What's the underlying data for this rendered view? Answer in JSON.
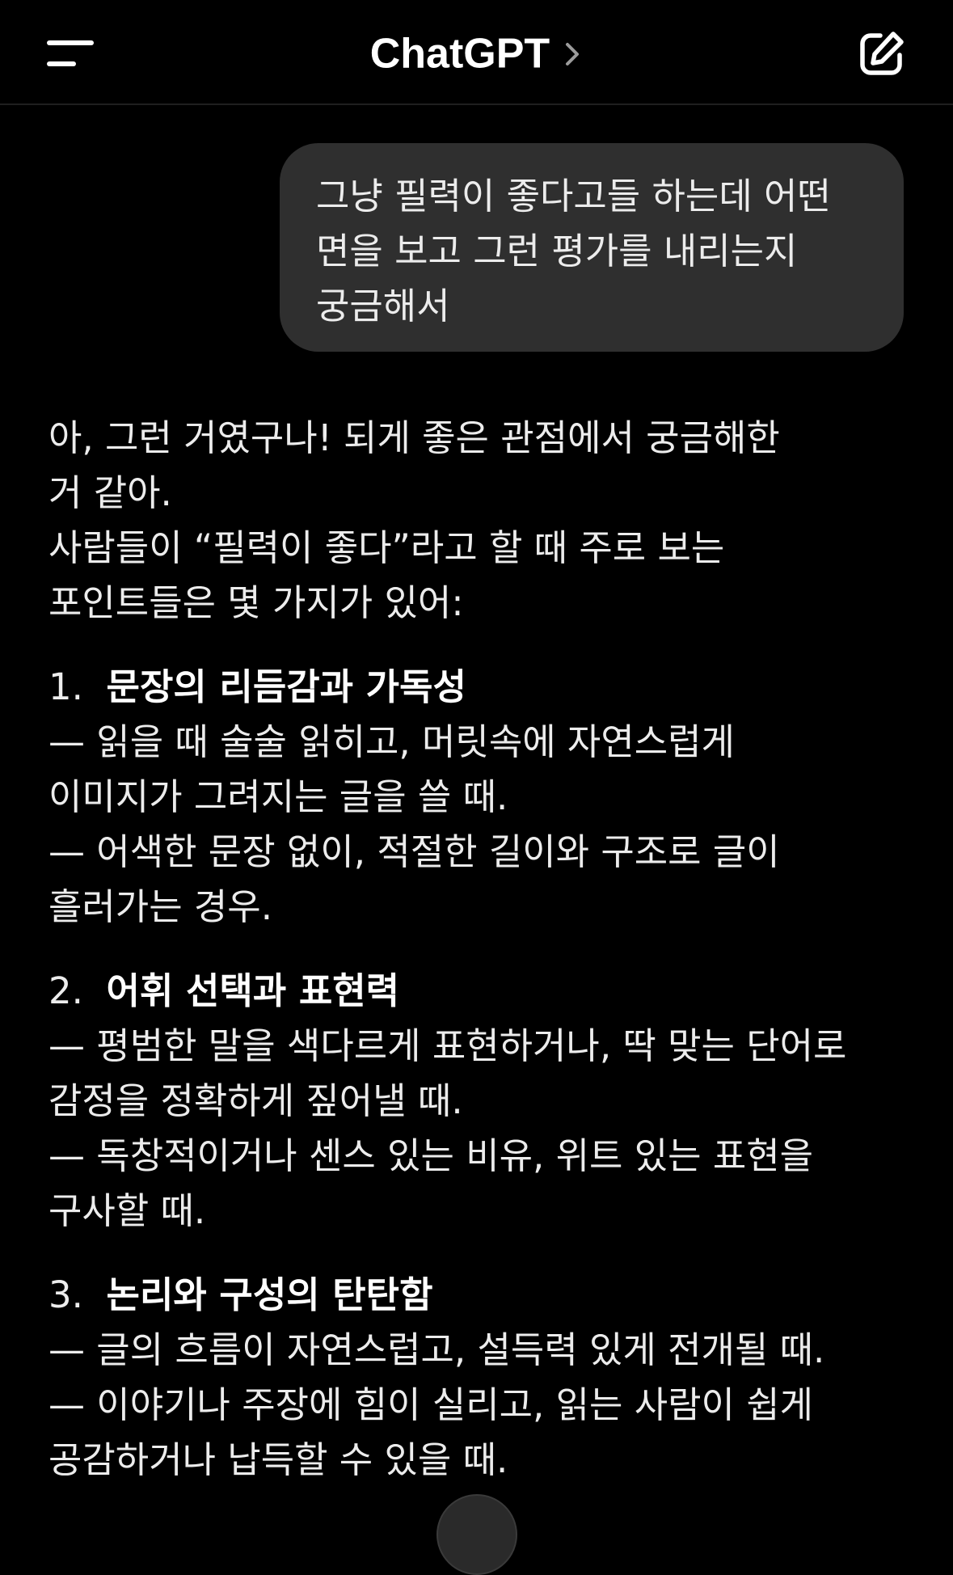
{
  "header": {
    "title": "ChatGPT",
    "menu_icon": "menu-icon",
    "chevron_icon": "chevron-right-icon",
    "edit_icon": "new-chat-icon"
  },
  "user_message": {
    "lines": [
      "그냥 필력이 좋다고들 하는데 어떤",
      "면을 보고 그런 평가를 내리는지",
      "궁금해서"
    ]
  },
  "assistant_message": {
    "intro": [
      "아, 그런 거였구나! 되게 좋은 관점에서 궁금해한",
      "거 같아.",
      "사람들이 “필력이 좋다”라고 할 때 주로 보는",
      "포인트들은 몇 가지가 있어:"
    ],
    "sections": [
      {
        "number": "1.",
        "title": "문장의 리듬감과 가독성",
        "lines": [
          "— 읽을 때 술술 읽히고, 머릿속에 자연스럽게",
          "이미지가 그려지는 글을 쓸 때.",
          "— 어색한 문장 없이, 적절한 길이와 구조로 글이",
          "흘러가는 경우."
        ]
      },
      {
        "number": "2.",
        "title": "어휘 선택과 표현력",
        "lines": [
          "— 평범한 말을 색다르게 표현하거나, 딱 맞는 단어로",
          "감정을 정확하게 짚어낼 때.",
          "— 독창적이거나 센스 있는 비유, 위트 있는 표현을",
          "구사할 때."
        ]
      },
      {
        "number": "3.",
        "title": "논리와 구성의 탄탄함",
        "lines": [
          "— 글의 흐름이 자연스럽고, 설득력 있게 전개될 때.",
          "— 이야기나 주장에 힘이 실리고, 읽는 사람이 쉽게",
          "공감하거나 납득할 수 있을 때."
        ]
      }
    ]
  },
  "colors": {
    "background": "#000000",
    "bubble": "#2f2f2f",
    "text": "#ececec"
  }
}
